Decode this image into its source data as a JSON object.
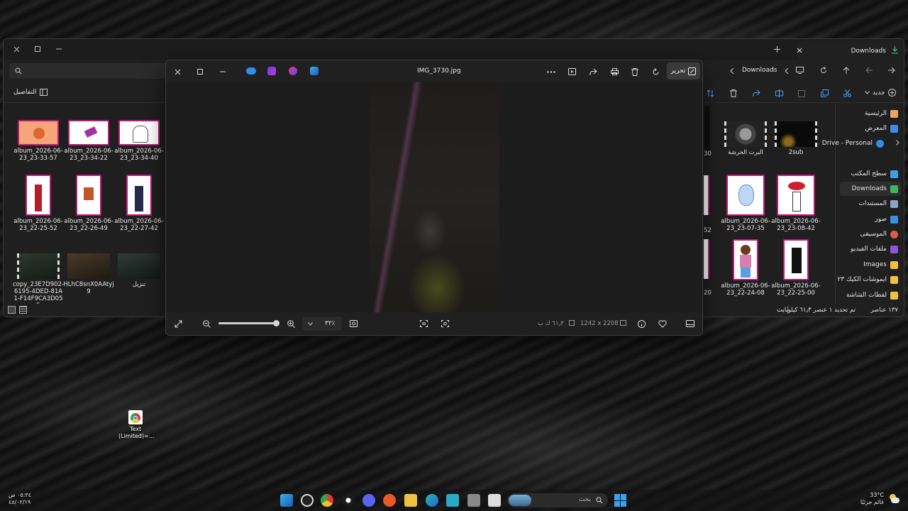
{
  "explorer": {
    "tab_title": "Downloads",
    "address": {
      "folder": "Downloads"
    },
    "details_label": "التفاصيل",
    "new_button": "جديد",
    "tiles_left": [
      {
        "label": "album_2026-06-23_23-33-57",
        "color": "#f6a57a"
      },
      {
        "label": "album_2026-06-23_23-34-22",
        "color": "#ffffff"
      },
      {
        "label": "album_2026-06-23_23-34-40",
        "color": "#ffffff"
      },
      {
        "label": "album_2026-06-23_22-25-52",
        "color": "#ffffff"
      },
      {
        "label": "album_2026-06-23_22-26-49",
        "color": "#ffffff"
      },
      {
        "label": "album_2026-06-23_22-27-42",
        "color": "#ffffff"
      },
      {
        "label": "copy_23E7D902-6195-4DED-81A1-F14F9CA3D055"
      },
      {
        "label": "HLhC8snX0AAtyj9"
      },
      {
        "label": "تنزيل"
      }
    ],
    "tiles_right": [
      {
        "label": "البرت الخرشة"
      },
      {
        "label": "2sub"
      },
      {
        "label": "album_2026-06-23_23-07-35"
      },
      {
        "label": "album_2026-06-23_23-08-42"
      },
      {
        "label": "album_2026-06-23_22-24-08"
      },
      {
        "label": "album_2026-06-23_22-25-00"
      }
    ],
    "partial_labels": [
      "30",
      "52",
      "20"
    ],
    "nav": [
      {
        "label": "الرئيسية",
        "color": "#e8a860"
      },
      {
        "label": "المعرض",
        "color": "#3a8ee6"
      },
      {
        "label": "Drive - Personal",
        "color": "#2f8fe8"
      },
      {
        "label": "سطح المكتب",
        "color": "#3aa0e8"
      },
      {
        "label": "Downloads",
        "color": "#3bb85a"
      },
      {
        "label": "المستندات",
        "color": "#8aa4c8"
      },
      {
        "label": "صور",
        "color": "#3a8ee6"
      },
      {
        "label": "الموسيقى",
        "color": "#e05a4a"
      },
      {
        "label": "ملفات الفيديو",
        "color": "#8a56d8"
      },
      {
        "label": "Images",
        "color": "#f0c040"
      },
      {
        "label": "ايموشات الكيك ٢٣",
        "color": "#f0c040"
      },
      {
        "label": "لقطات الشاشة",
        "color": "#f0c040"
      }
    ],
    "status": {
      "count": "١٣٧ عناصر",
      "selected": "تم تحديد ١ عنصر  ٦١٫٣ كيلوبايت"
    }
  },
  "viewer": {
    "filename": "IMG_3730.jpg",
    "edit_label": "تحرير",
    "zoom": "٣٢٪",
    "zoom_level": 0.95,
    "dimensions": "1242 x 2208",
    "size": "٦١٫٣ ك ب"
  },
  "desktop": {
    "icon_label": "Text (Limited)=..."
  },
  "taskbar": {
    "search_placeholder": "بحث",
    "weather_temp": "33°C",
    "weather_desc": "غائم جزئيًا",
    "time": "٠٥:٣٤ ص",
    "date": "٤٨/٠٢/١٩"
  }
}
